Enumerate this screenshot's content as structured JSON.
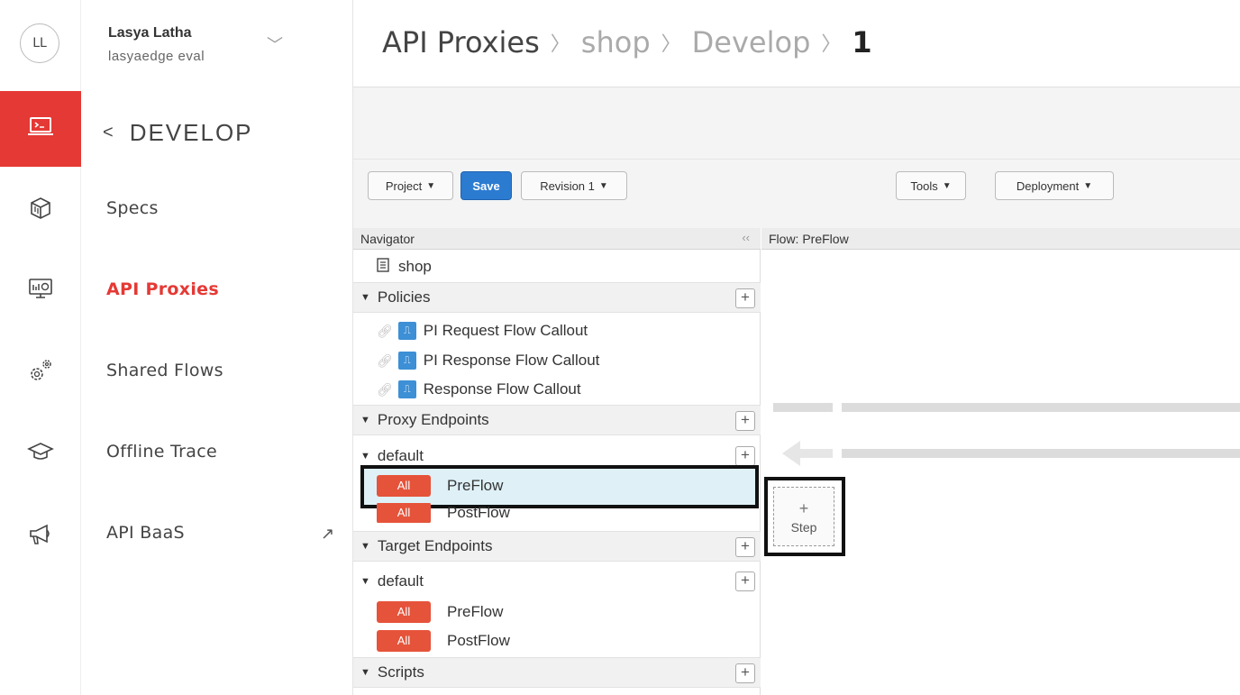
{
  "user": {
    "initials": "LL",
    "name": "Lasya Latha",
    "subtitle": "lasyaedge eval"
  },
  "rail": {
    "icons": [
      "develop-icon",
      "cube-icon",
      "monitor-analytics-icon",
      "gears-icon",
      "graduation-cap-icon",
      "megaphone-icon"
    ],
    "active_color": "#e53935"
  },
  "sidenav": {
    "section_title": "DEVELOP",
    "items": [
      {
        "label": "Specs"
      },
      {
        "label": "API Proxies",
        "active": true
      },
      {
        "label": "Shared Flows"
      },
      {
        "label": "Offline Trace"
      },
      {
        "label": "API BaaS"
      }
    ]
  },
  "breadcrumb": {
    "part1": "API Proxies",
    "part2": "shop",
    "part3": "Develop",
    "part4": "1"
  },
  "toolbar": {
    "project": "Project",
    "save": "Save",
    "revision": "Revision 1",
    "tools": "Tools",
    "deployment": "Deployment"
  },
  "navigator": {
    "title": "Navigator",
    "collapse": "‹‹",
    "proxy_name": "shop",
    "policies_label": "Policies",
    "policies": [
      "PI Request Flow Callout",
      "PI Response Flow Callout",
      "Response Flow Callout"
    ],
    "proxy_endpoints_label": "Proxy Endpoints",
    "proxy_default": "default",
    "proxy_flows": [
      {
        "badge": "All",
        "label": "PreFlow"
      },
      {
        "badge": "All",
        "label": "PostFlow"
      }
    ],
    "target_endpoints_label": "Target Endpoints",
    "target_default": "default",
    "target_flows": [
      {
        "badge": "All",
        "label": "PreFlow"
      },
      {
        "badge": "All",
        "label": "PostFlow"
      }
    ],
    "scripts_label": "Scripts"
  },
  "flow": {
    "title": "Flow: PreFlow",
    "step_label": "Step"
  },
  "colors": {
    "accent_red": "#e53935",
    "badge_red": "#e5533a",
    "save_blue": "#2b7bd1",
    "selected_row": "#dff1f7"
  }
}
